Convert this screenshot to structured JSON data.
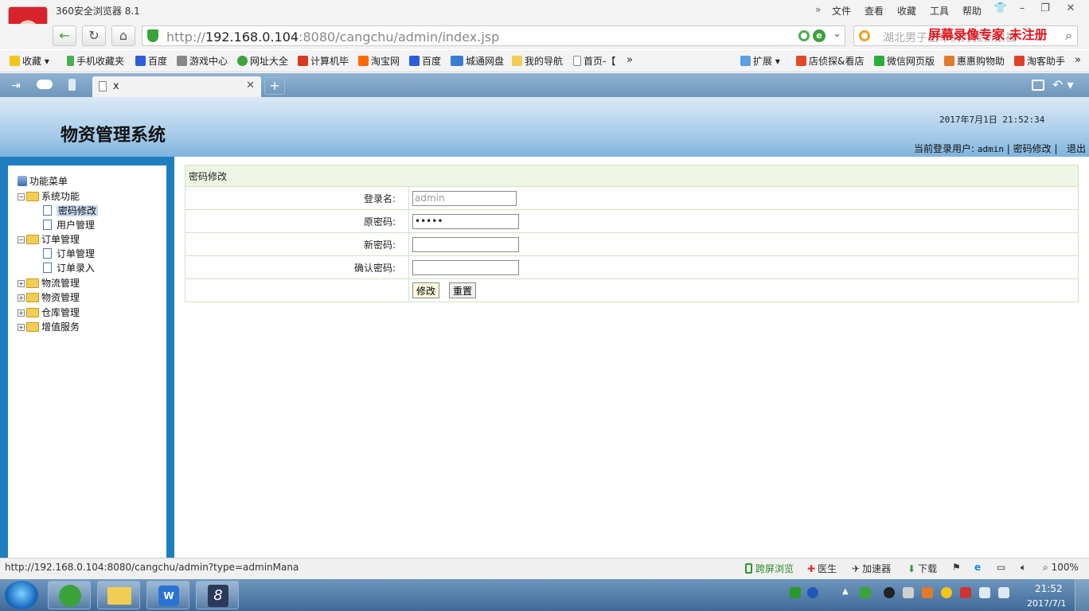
{
  "browser": {
    "title": "360安全浏览器 8.1",
    "menus": [
      "文件",
      "查看",
      "收藏",
      "工具",
      "帮助"
    ],
    "url_host": "192.168.0.104",
    "url_prefix": "http://",
    "url_suffix": ":8080/cangchu/admin/index.jsp",
    "search_text": "湖北男子出车祸为救新娘被",
    "watermark": "屏幕录像专家 未注册",
    "bookmarks": [
      "收藏",
      "手机收藏夹",
      "百度",
      "游戏中心",
      "网址大全",
      "计算机毕",
      "淘宝网",
      "百度",
      "城通网盘",
      "我的导航",
      "首页-【"
    ],
    "bookmarks_right": [
      "扩展",
      "店侦探&看店",
      "微信网页版",
      "惠惠购物助",
      "淘客助手"
    ],
    "tab_label": "x",
    "status_url": "http://192.168.0.104:8080/cangchu/admin?type=adminMana",
    "status_items": [
      "跨屏浏览",
      "医生",
      "加速器",
      "下载"
    ],
    "zoom": "100%"
  },
  "app": {
    "system_title": "物资管理系统",
    "datetime": "2017年7月1日 21:52:34",
    "current_user_label": "当前登录用户:",
    "current_user": "admin",
    "change_password_link": "密码修改",
    "logout_link": "退出"
  },
  "menu": {
    "root": "功能菜单",
    "groups": [
      {
        "label": "系统功能",
        "children": [
          "密码修改",
          "用户管理"
        ]
      },
      {
        "label": "订单管理",
        "children": [
          "订单管理",
          "订单录入"
        ]
      },
      {
        "label": "物流管理"
      },
      {
        "label": "物资管理"
      },
      {
        "label": "仓库管理"
      },
      {
        "label": "增值服务"
      }
    ]
  },
  "form": {
    "header": "密码修改",
    "login_name_label": "登录名:",
    "login_name_value": "admin",
    "old_password_label": "原密码:",
    "old_password_value": "•••••",
    "new_password_label": "新密码:",
    "confirm_password_label": "确认密码:",
    "submit_label": "修改",
    "reset_label": "重置"
  },
  "taskbar": {
    "time": "21:52",
    "date": "2017/7/1"
  }
}
